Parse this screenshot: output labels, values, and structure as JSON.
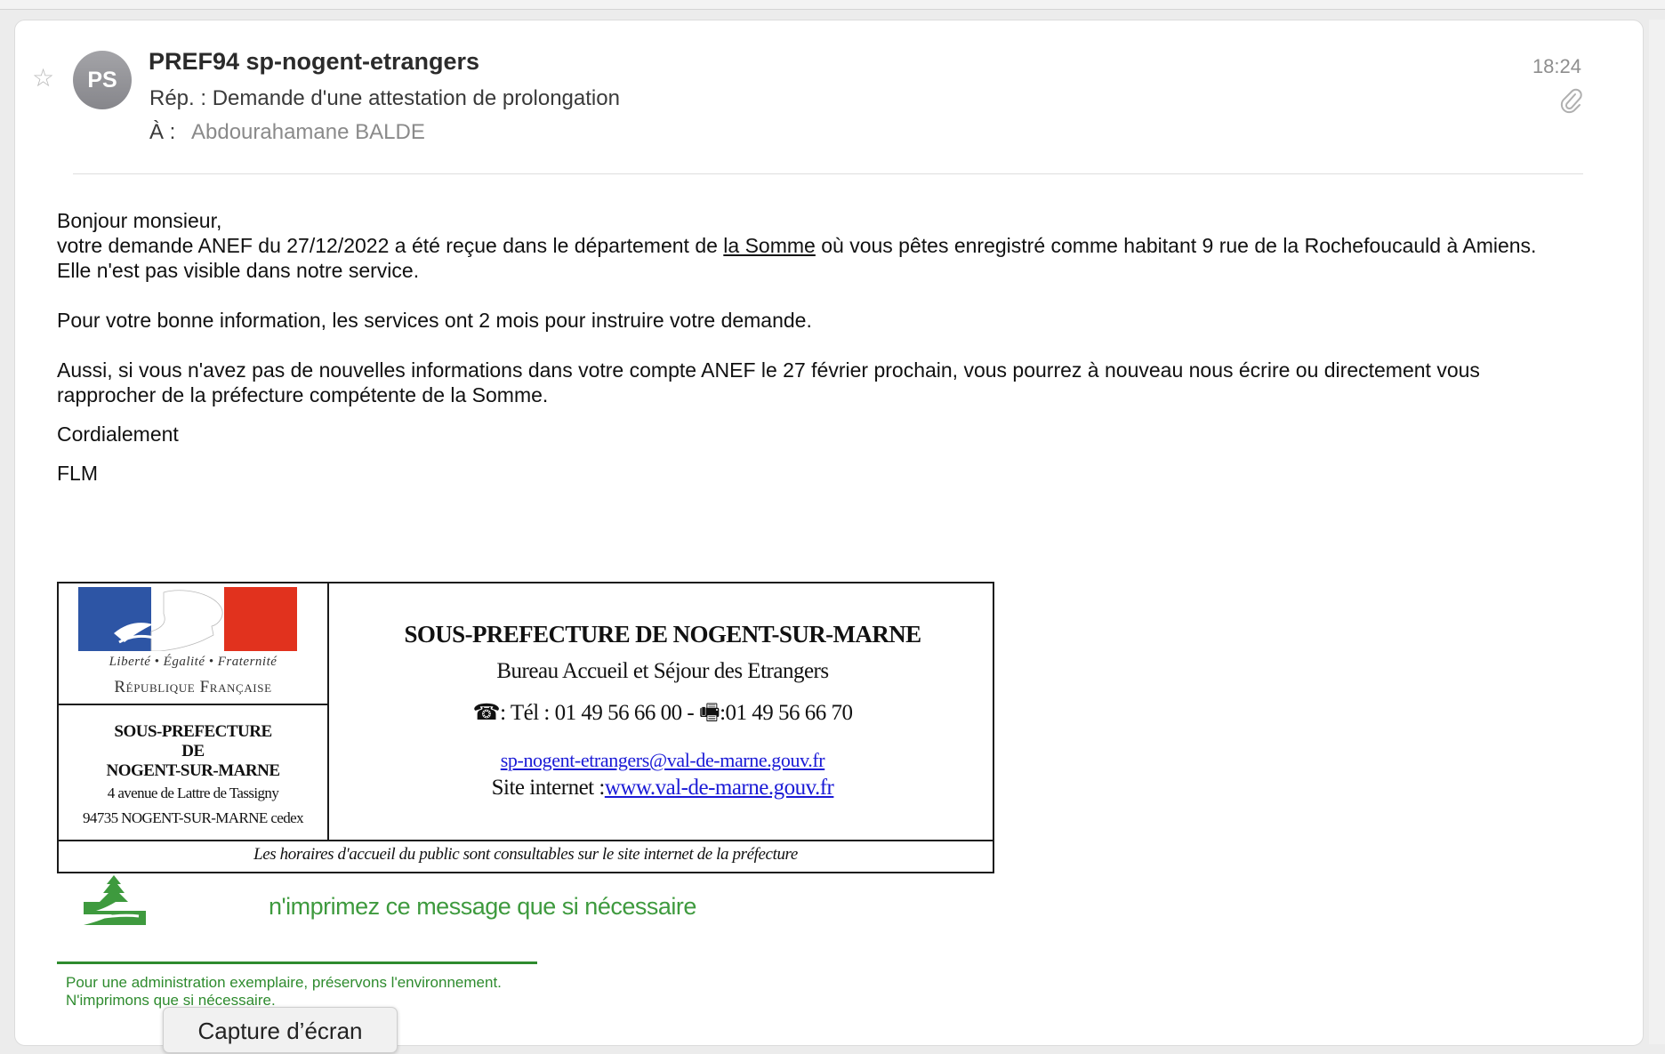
{
  "message": {
    "avatar_initials": "PS",
    "sender": "PREF94 sp-nogent-etrangers",
    "subject": "Rép. : Demande d'une attestation de prolongation",
    "to_label": "À :",
    "to_value": "Abdourahamane BALDE",
    "time": "18:24"
  },
  "body": {
    "greeting": "Bonjour monsieur,",
    "line1_before": "votre demande ANEF du 27/12/2022 a été reçue dans le département de ",
    "line1_link": "la Somme",
    "line1_after": " où vous pêtes enregistré comme habitant 9 rue de la Rochefoucauld à Amiens.",
    "line2": "Elle n'est pas visible dans notre service.",
    "para2": "Pour votre bonne information, les services ont 2 mois pour instruire votre demande.",
    "para3": "Aussi, si vous n'avez pas de nouvelles informations dans votre compte ANEF le 27 février prochain, vous pourrez à nouveau nous écrire ou directement vous rapprocher de la préfecture compétente de la Somme.",
    "closing": "Cordialement",
    "sign": "FLM"
  },
  "signature": {
    "devise": "Liberté • Égalité • Fraternité",
    "republique": "République Française",
    "left_title_1": "SOUS-PREFECTURE",
    "left_title_2": "DE",
    "left_title_3": "NOGENT-SUR-MARNE",
    "address_1": "4 avenue de Lattre de Tassigny",
    "address_2": "94735 NOGENT-SUR-MARNE cedex",
    "title": "SOUS-PREFECTURE DE NOGENT-SUR-MARNE",
    "bureau": "Bureau Accueil et Séjour des Etrangers",
    "tel_icon": "☎",
    "tel": ": Tél : 01 49 56 66 00 - ",
    "fax_icon": "🖷",
    "fax": ":01 49 56 66 70",
    "email": "sp-nogent-etrangers@val-de-marne.gouv.fr",
    "site_label": "Site internet :",
    "site_link": "www.val-de-marne.gouv.fr",
    "horaires": "Les horaires d'accueil du public sont consultables sur le site internet de la préfecture"
  },
  "eco": {
    "text": "n'imprimez ce message que si nécessaire",
    "note_1": "Pour une administration exemplaire, préservons l'environnement.",
    "note_2": "N'imprimons que si nécessaire."
  },
  "tooltip": "Capture d’écran",
  "colors": {
    "link": "#1a1ad6",
    "eco_green": "#3e9a3e",
    "flag_blue": "#2d55a5",
    "flag_red": "#e1321e"
  },
  "icons": {
    "star": "star-icon",
    "attachment": "paperclip-icon",
    "phone": "phone-icon",
    "fax": "fax-icon",
    "eco": "tree-icon"
  }
}
